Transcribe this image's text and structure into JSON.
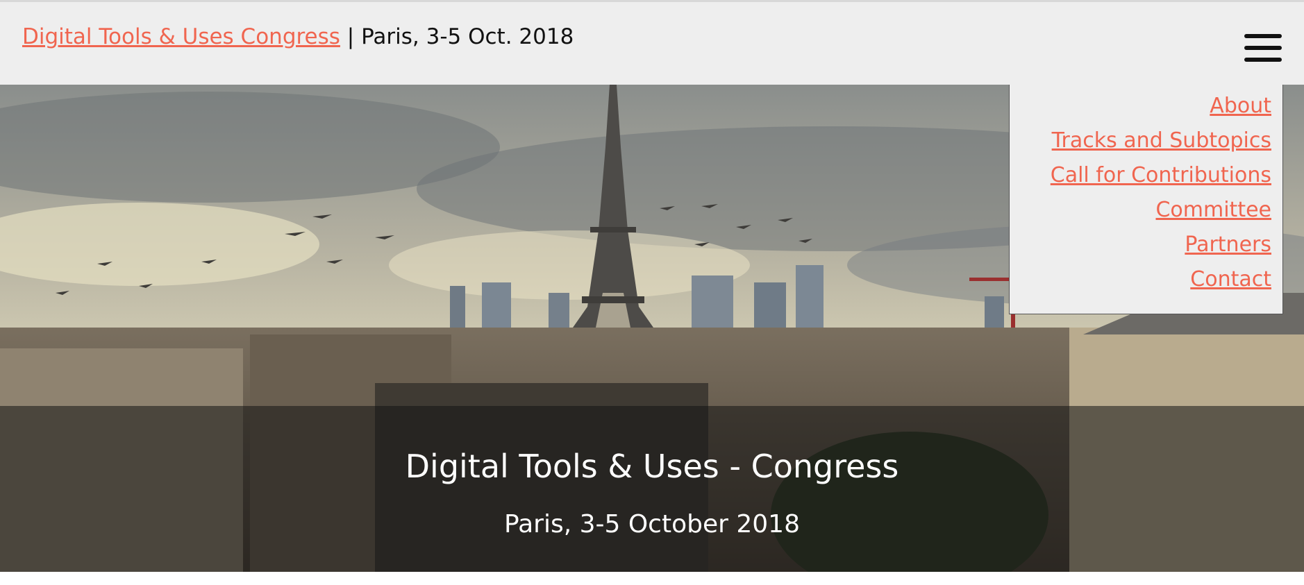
{
  "header": {
    "site_link": "Digital Tools & Uses Congress",
    "tagline": " | Paris, 3-5 Oct. 2018",
    "menu_icon": "hamburger-menu-icon"
  },
  "nav_menu": {
    "items": [
      {
        "label": "About"
      },
      {
        "label": "Tracks and Subtopics"
      },
      {
        "label": "Call for Contributions"
      },
      {
        "label": "Committee"
      },
      {
        "label": "Partners"
      },
      {
        "label": "Contact"
      }
    ]
  },
  "hero": {
    "title": "Digital Tools & Uses - Congress",
    "subtitle": "Paris, 3-5 October 2018",
    "image_subject": "paris-skyline-eiffel-tower"
  },
  "colors": {
    "link": "#f0654f",
    "header_bg": "#eeeeee",
    "text": "#111111"
  }
}
